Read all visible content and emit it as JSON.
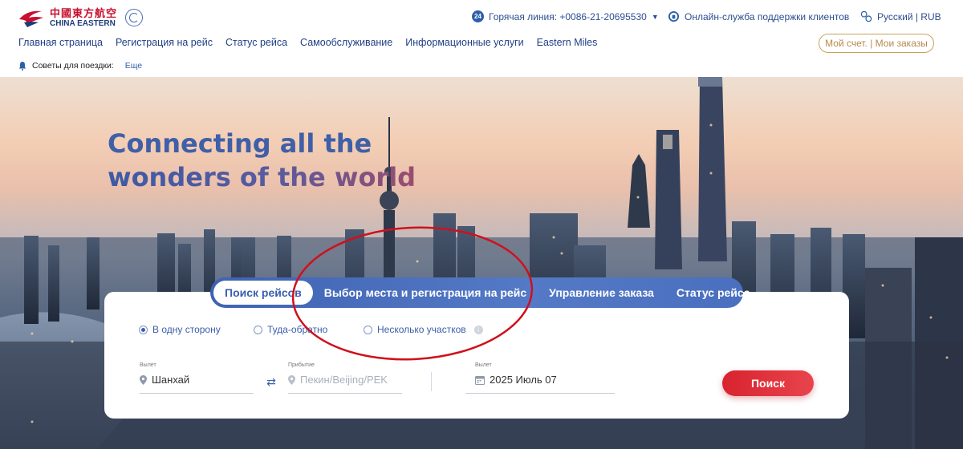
{
  "brand": {
    "name_cn": "中國東方航空",
    "name_en": "CHINA EASTERN",
    "skyteam_label": "SKYTEAM"
  },
  "utility": {
    "hotline": "Горячая линия: +0086-21-20695530",
    "support": "Онлайн-служба поддержки клиентов",
    "language": "Русский | RUB"
  },
  "nav": {
    "items": [
      {
        "label": "Главная страница"
      },
      {
        "label": "Регистрация на рейс"
      },
      {
        "label": "Статус рейса"
      },
      {
        "label": "Самообслуживание"
      },
      {
        "label": "Информационные услуги"
      },
      {
        "label": "Eastern Miles"
      }
    ],
    "account_label": "Мой счет. | Мои заказы"
  },
  "tips": {
    "label": "Советы для поездки:",
    "more": "Еще"
  },
  "hero": {
    "slogan_line1": "Connecting all the",
    "slogan_line2": "wonders of the world"
  },
  "booking": {
    "tabs": [
      {
        "label": "Поиск рейсов",
        "active": true
      },
      {
        "label": "Выбор места и регистрация на рейс",
        "active": false
      },
      {
        "label": "Управление заказа",
        "active": false
      },
      {
        "label": "Статус рейса",
        "active": false
      }
    ],
    "trip_types": [
      {
        "label": "В одну сторону",
        "checked": true
      },
      {
        "label": "Туда-обратно",
        "checked": false
      },
      {
        "label": "Несколько участков",
        "checked": false
      }
    ],
    "departure": {
      "label": "Вылет",
      "value": "Шанхай"
    },
    "arrival": {
      "label": "Прибытие",
      "placeholder": "Пекин/Beijing/PEK"
    },
    "date": {
      "label": "Вылет",
      "value": "2025 Июль 07"
    },
    "search_label": "Поиск"
  },
  "colors": {
    "brand_red": "#c8102e",
    "nav_blue": "#1f3f86",
    "tab_blue": "#4a6fbf",
    "search_red": "#e0303a",
    "annotation": "#d0101c"
  }
}
